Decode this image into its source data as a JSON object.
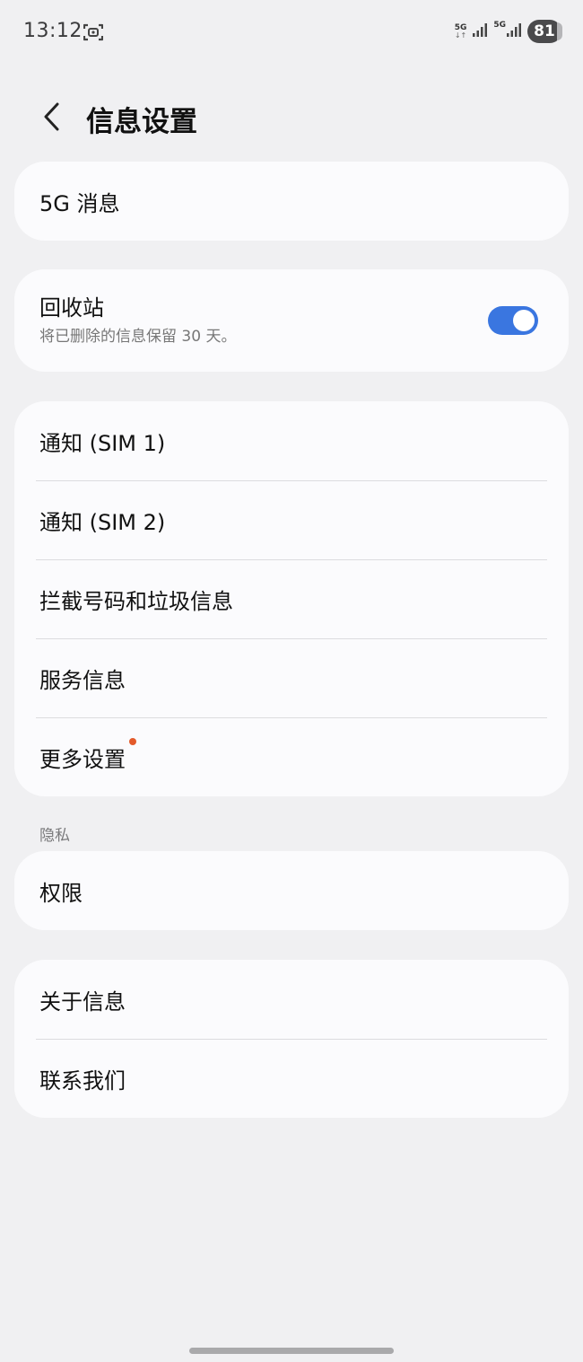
{
  "status_bar": {
    "time": "13:12",
    "sim1_network": "5G",
    "sim2_network": "5G",
    "battery": "81"
  },
  "header": {
    "title": "信息设置"
  },
  "card_5g": {
    "label": "5G 消息"
  },
  "recycle_bin": {
    "title": "回收站",
    "subtitle": "将已删除的信息保留 30 天。",
    "enabled": true
  },
  "settings_card": {
    "items": [
      {
        "label": "通知 (SIM 1)"
      },
      {
        "label": "通知 (SIM 2)"
      },
      {
        "label": "拦截号码和垃圾信息"
      },
      {
        "label": "服务信息"
      },
      {
        "label": "更多设置",
        "badge": true
      }
    ]
  },
  "privacy": {
    "section_label": "隐私",
    "items": [
      {
        "label": "权限"
      }
    ]
  },
  "about_card": {
    "items": [
      {
        "label": "关于信息"
      },
      {
        "label": "联系我们"
      }
    ]
  },
  "colors": {
    "accent": "#3a76e0",
    "badge": "#e35a2a",
    "background": "#f0f0f2",
    "card": "#fbfbfd"
  }
}
